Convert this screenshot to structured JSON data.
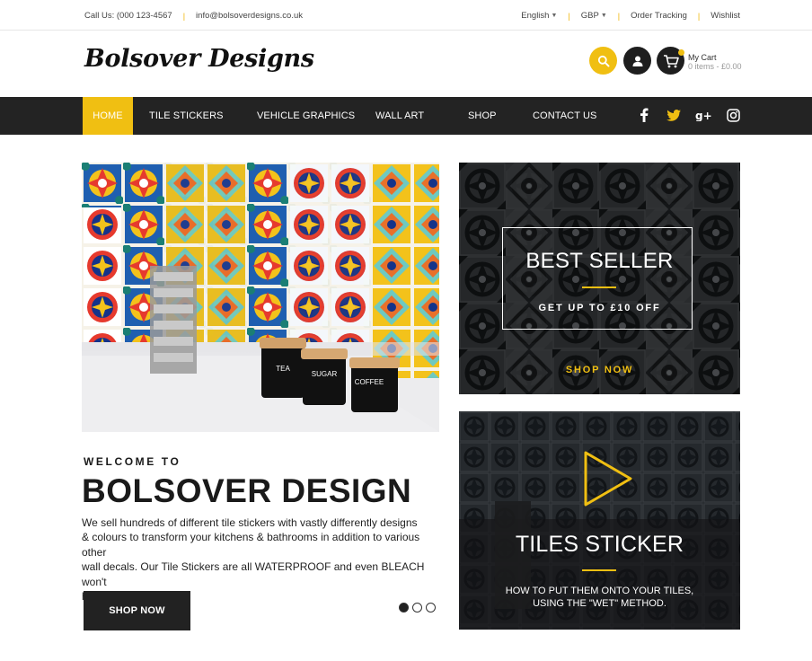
{
  "topbar": {
    "phone": "Call Us: (000 123-4567",
    "email": "info@bolsoverdesigns.co.uk",
    "language": "English",
    "currency": "GBP",
    "order_tracking": "Order Tracking",
    "wishlist": "Wishlist"
  },
  "header": {
    "logo": "Bolsover Designs",
    "cart_title": "My Cart",
    "cart_summary": "0 items - £0.00"
  },
  "nav": {
    "items": [
      "HOME",
      "TILE STICKERS",
      "VEHICLE GRAPHICS",
      "WALL ART",
      "SHOP",
      "CONTACT US"
    ],
    "active": "HOME",
    "social": [
      "facebook-icon",
      "twitter-icon",
      "google-plus-icon",
      "instagram-icon"
    ]
  },
  "hero": {
    "jar_labels": [
      "TEA",
      "SUGAR",
      "COFFEE"
    ],
    "kicker": "WELCOME TO",
    "title": "BOLSOVER DESIGN",
    "desc_lines": [
      "We sell hundreds of different tile stickers with vastly differently designs",
      "& colours to transform your kitchens & bathrooms in addition to various other",
      "wall decals. Our Tile Stickers are all WATERPROOF and even BLEACH won't",
      "hurt them!"
    ],
    "button": "SHOP NOW",
    "slides": 3,
    "active_slide": 1
  },
  "promo_best": {
    "title": "BEST SELLER",
    "subtitle": "GET UP TO £10 OFF",
    "link": "SHOP NOW"
  },
  "promo_tiles": {
    "title": "TILES STICKER",
    "subtitle_line1": "HOW TO PUT THEM ONTO YOUR TILES,",
    "subtitle_line2": "USING THE \"WET\" METHOD."
  },
  "colors": {
    "accent": "#f0bf12",
    "nav_bg": "#232323",
    "dark": "#1e1e1e"
  }
}
